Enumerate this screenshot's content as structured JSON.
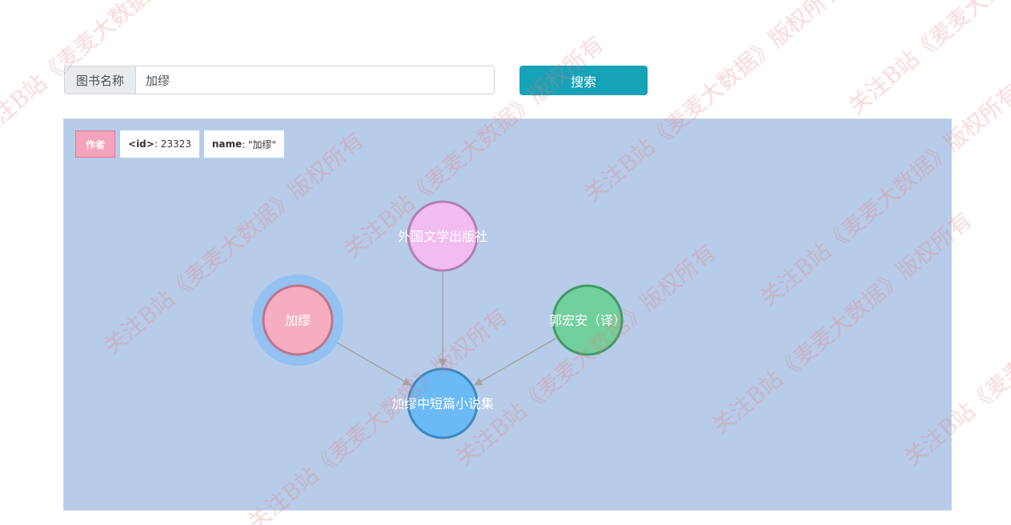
{
  "search": {
    "label": "图书名称",
    "value": "加缪",
    "button_label": "搜索"
  },
  "selected_node": {
    "label": "作者",
    "id_key": "<id>",
    "id_value": ": 23323",
    "name_key": "name",
    "name_value": ": \"加缪\""
  },
  "graph": {
    "nodes": [
      {
        "id": "publisher",
        "label": "外国文学出版社",
        "fill": "#f2bcf0",
        "stroke": "#b080b2"
      },
      {
        "id": "author",
        "label": "加缪",
        "fill": "#f6adbf",
        "stroke": "#c0758a",
        "selected": true
      },
      {
        "id": "translator",
        "label": "郭宏安（译）",
        "fill": "#72d09c",
        "stroke": "#3f9a68"
      },
      {
        "id": "book",
        "label": "加缪中短篇小说集",
        "fill": "#6bb9f5",
        "stroke": "#3e87c0"
      }
    ],
    "edges": [
      {
        "from": "publisher",
        "to": "book"
      },
      {
        "from": "author",
        "to": "book"
      },
      {
        "from": "translator",
        "to": "book"
      }
    ],
    "edge_color": "#a5a5a5",
    "highlight_color": "#8fc0f2"
  },
  "watermark": {
    "text": "关注B站《麦麦大数据》版权所有"
  }
}
